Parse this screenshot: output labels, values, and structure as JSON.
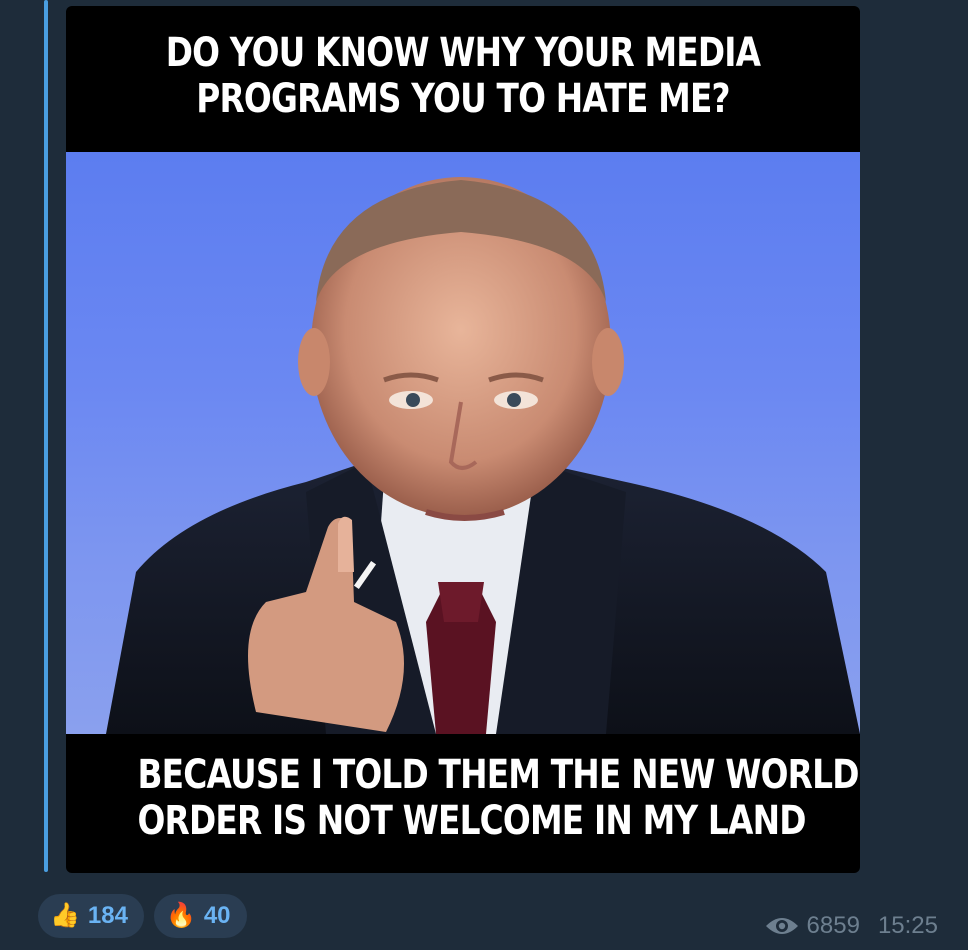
{
  "meme": {
    "top_caption_line1": "DO YOU KNOW WHY YOUR MEDIA",
    "top_caption_line2": "PROGRAMS YOU TO HATE ME?",
    "bottom_caption_line1": "BECAUSE I TOLD THEM THE NEW WORLD",
    "bottom_caption_line2": "ORDER IS NOT WELCOME IN MY LAND"
  },
  "reactions": [
    {
      "emoji": "👍",
      "icon": "thumbs-up-icon",
      "count": "184"
    },
    {
      "emoji": "🔥",
      "icon": "fire-icon",
      "count": "40"
    }
  ],
  "meta": {
    "views": "6859",
    "time": "15:25",
    "icon": "eye-icon"
  },
  "colors": {
    "background": "#1e2c3a",
    "accent": "#4a9ee0",
    "reaction_text": "#6ab3f3",
    "meta_text": "#6d7f8f"
  }
}
